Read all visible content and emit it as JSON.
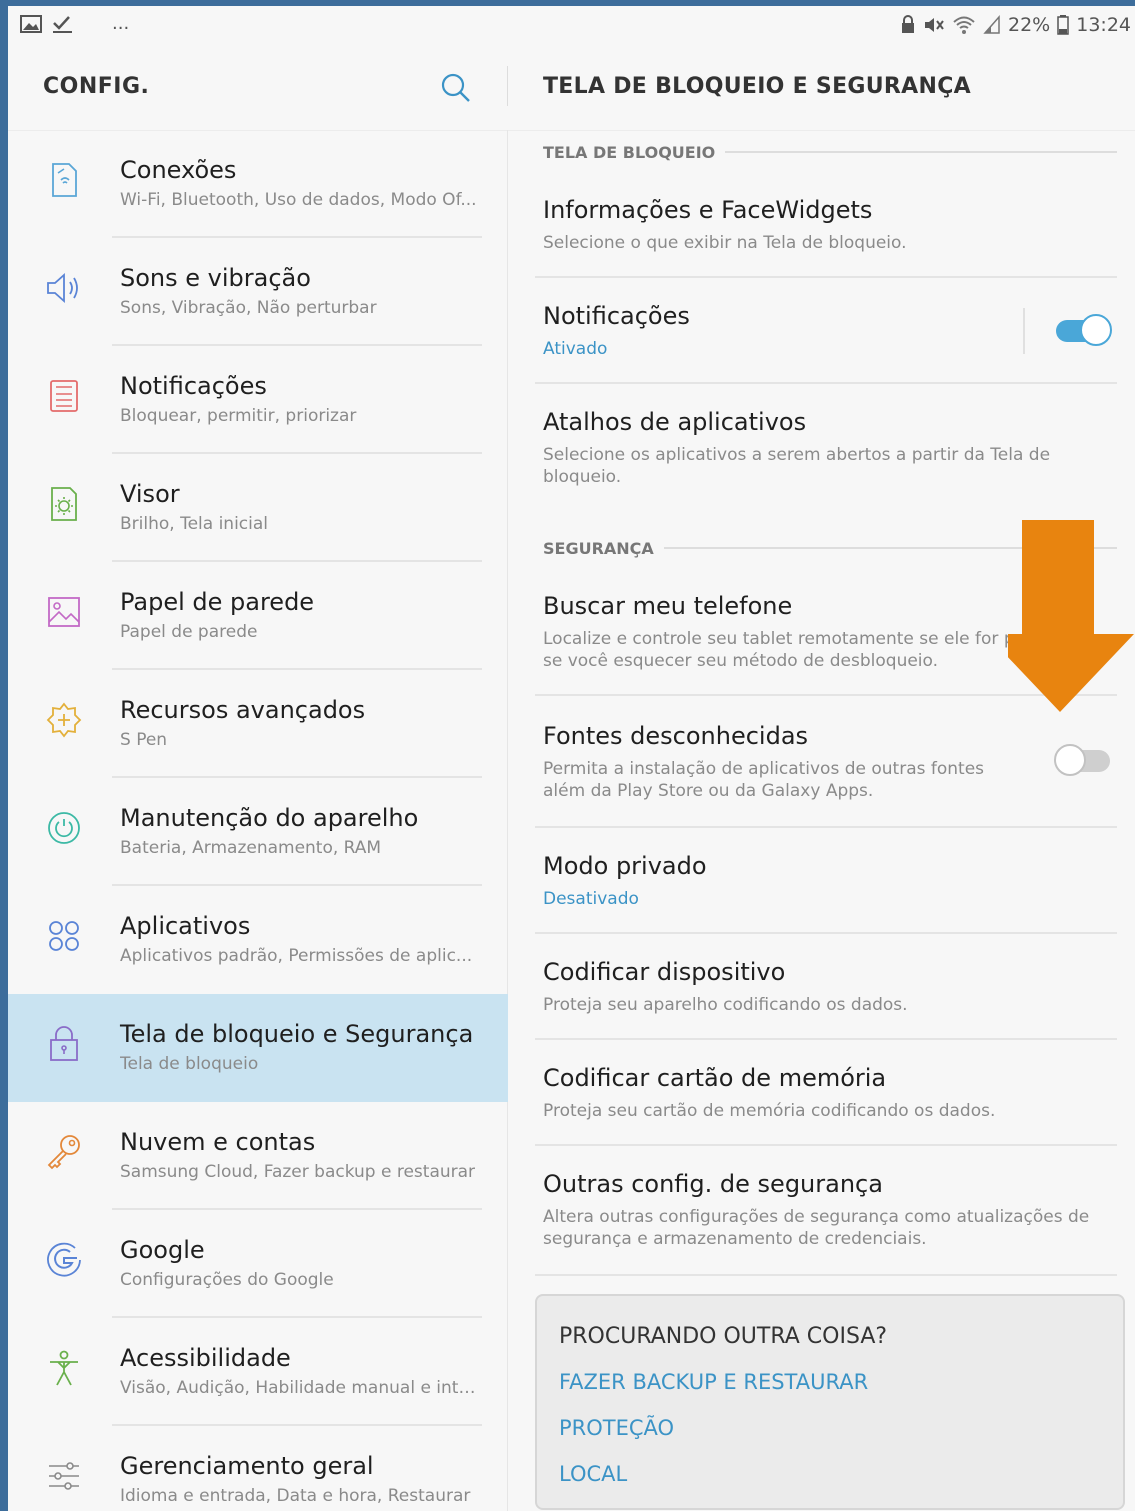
{
  "status": {
    "battery": "22%",
    "time": "13:24",
    "overflow": "..."
  },
  "left": {
    "title": "CONFIG.",
    "items": [
      {
        "title": "Conexões",
        "sub": "Wi-Fi, Bluetooth, Uso de dados, Modo Of..."
      },
      {
        "title": "Sons e vibração",
        "sub": "Sons, Vibração, Não perturbar"
      },
      {
        "title": "Notificações",
        "sub": "Bloquear, permitir, priorizar"
      },
      {
        "title": "Visor",
        "sub": "Brilho, Tela inicial"
      },
      {
        "title": "Papel de parede",
        "sub": "Papel de parede"
      },
      {
        "title": "Recursos avançados",
        "sub": "S Pen"
      },
      {
        "title": "Manutenção do aparelho",
        "sub": "Bateria, Armazenamento, RAM"
      },
      {
        "title": "Aplicativos",
        "sub": "Aplicativos padrão, Permissões de aplic..."
      },
      {
        "title": "Tela de bloqueio e Segurança",
        "sub": "Tela de bloqueio"
      },
      {
        "title": "Nuvem e contas",
        "sub": "Samsung Cloud, Fazer backup e restaurar"
      },
      {
        "title": "Google",
        "sub": "Configurações do Google"
      },
      {
        "title": "Acessibilidade",
        "sub": "Visão, Audição, Habilidade manual e inte..."
      },
      {
        "title": "Gerenciamento geral",
        "sub": "Idioma e entrada, Data e hora, Restaurar"
      }
    ]
  },
  "right": {
    "title": "TELA DE BLOQUEIO E SEGURANÇA",
    "section_lock": "TELA DE BLOQUEIO",
    "section_security": "SEGURANÇA",
    "settings": {
      "info": {
        "title": "Informações e FaceWidgets",
        "sub": "Selecione o que exibir na Tela de bloqueio."
      },
      "notif": {
        "title": "Notificações",
        "sub": "Ativado",
        "toggle": "on"
      },
      "shortcuts": {
        "title": "Atalhos de aplicativos",
        "sub": "Selecione os aplicativos a serem abertos a partir da Tela de bloqueio."
      },
      "findphone": {
        "title": "Buscar meu telefone",
        "sub": "Localize e controle seu tablet remotamente se ele for perdido ou se você esquecer seu método de desbloqueio."
      },
      "unknown": {
        "title": "Fontes desconhecidas",
        "sub": "Permita a instalação de aplicativos de outras fontes além da Play Store ou da Galaxy Apps.",
        "toggle": "off"
      },
      "private": {
        "title": "Modo privado",
        "sub": "Desativado"
      },
      "encrypt": {
        "title": "Codificar dispositivo",
        "sub": "Proteja seu aparelho codificando os dados."
      },
      "sdcard": {
        "title": "Codificar cartão de memória",
        "sub": "Proteja seu cartão de memória codificando os dados."
      },
      "other": {
        "title": "Outras config. de segurança",
        "sub": "Altera outras configurações de segurança como atualizações de segurança e armazenamento de credenciais."
      }
    },
    "card": {
      "title": "PROCURANDO OUTRA COISA?",
      "links": [
        "FAZER BACKUP E RESTAURAR",
        "PROTEÇÃO",
        "LOCAL"
      ]
    }
  },
  "colors": {
    "accent": "#3b93c6",
    "active_row": "#c9e3f1",
    "arrow": "#e8840f",
    "frame": "#3d6d9b"
  },
  "icons": [
    "connections-icon",
    "sound-icon",
    "notifications-icon",
    "display-icon",
    "wallpaper-icon",
    "advanced-features-icon",
    "device-maintenance-icon",
    "apps-icon",
    "lock-icon",
    "key-icon",
    "google-icon",
    "accessibility-icon",
    "sliders-icon",
    "search-icon"
  ]
}
